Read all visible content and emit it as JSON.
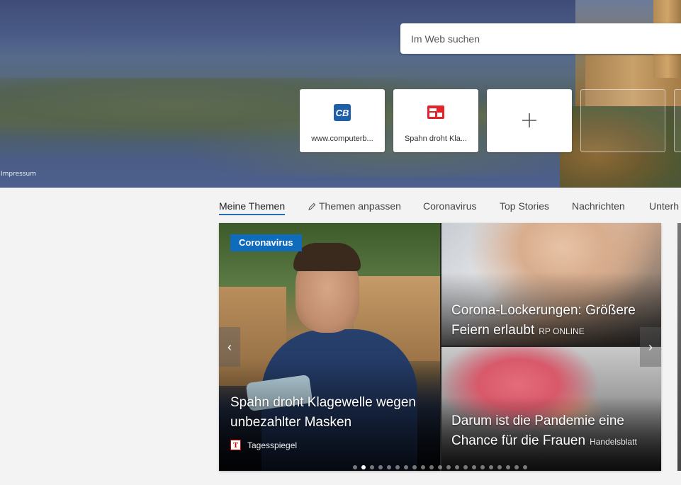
{
  "hero": {
    "impressum": "Impressum",
    "search_placeholder": "Im Web suchen"
  },
  "tiles": [
    {
      "label": "www.computerb...",
      "icon": "computerbild-icon"
    },
    {
      "label": "Spahn droht Kla...",
      "icon": "news-icon"
    },
    {
      "label": "",
      "icon": "plus-icon"
    }
  ],
  "tabs": [
    {
      "label": "Meine Themen",
      "active": true
    },
    {
      "label": "Themen anpassen",
      "icon": "pencil-icon"
    },
    {
      "label": "Coronavirus"
    },
    {
      "label": "Top Stories"
    },
    {
      "label": "Nachrichten"
    },
    {
      "label": "Unterh"
    }
  ],
  "news": {
    "badge": "Coronavirus",
    "main": {
      "line1": "Spahn droht Klagewelle wegen",
      "line2": "unbezahlter Masken",
      "source": "Tagesspiegel",
      "source_logo": "T"
    },
    "top": {
      "line1": "Corona-Lockerungen: Größere",
      "line2": "Feiern erlaubt",
      "source": "RP ONLINE"
    },
    "bottom": {
      "line1": "Darum ist die Pandemie eine",
      "line2": "Chance für die Frauen",
      "source": "Handelsblatt"
    },
    "arrows": {
      "prev": "‹",
      "next": "›"
    },
    "dots_total": 21,
    "dots_active_index": 1
  }
}
